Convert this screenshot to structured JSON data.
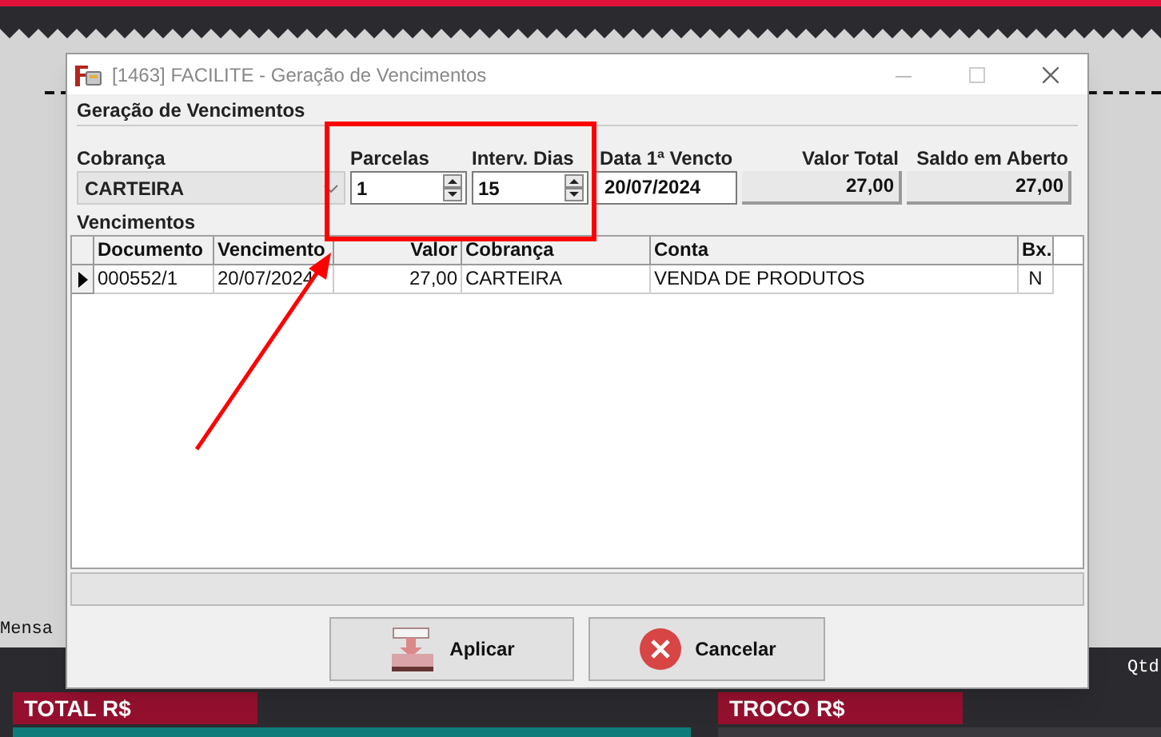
{
  "background": {
    "message_label": "Mensa",
    "quantity_label": "Qtd",
    "panels": [
      {
        "label": "TOTAL R$"
      },
      {
        "label": "TROCO R$"
      }
    ]
  },
  "dialog": {
    "title": "[1463] FACILITE - Geração de Vencimentos",
    "group_title": "Geração de Vencimentos",
    "fields": [
      {
        "kind": "combo",
        "label": "Cobrança",
        "value": "CARTEIRA"
      },
      {
        "kind": "spin",
        "label": "Parcelas",
        "value": "1"
      },
      {
        "kind": "spin",
        "label": "Interv. Dias",
        "value": "15"
      },
      {
        "kind": "text",
        "label": "Data 1ª Vencto",
        "value": "20/07/2024"
      },
      {
        "kind": "readonly",
        "label": "Valor Total",
        "value": "27,00"
      },
      {
        "kind": "readonly",
        "label": "Saldo em Aberto",
        "value": "27,00"
      }
    ],
    "list_title": "Vencimentos",
    "table": {
      "columns": [
        {
          "label": "Documento"
        },
        {
          "label": "Vencimento"
        },
        {
          "label": "Valor"
        },
        {
          "label": "Cobrança"
        },
        {
          "label": "Conta"
        },
        {
          "label": "Bx."
        }
      ],
      "rows": [
        {
          "selected": true,
          "cells": [
            "000552/1",
            "20/07/2024",
            "27,00",
            "CARTEIRA",
            "VENDA DE PRODUTOS",
            "N"
          ]
        }
      ]
    },
    "buttons": [
      {
        "kind": "apply",
        "label": "Aplicar"
      },
      {
        "kind": "cancel",
        "label": "Cancelar"
      }
    ]
  },
  "annotations": [
    {
      "kind": "box"
    },
    {
      "kind": "arrow"
    }
  ]
}
